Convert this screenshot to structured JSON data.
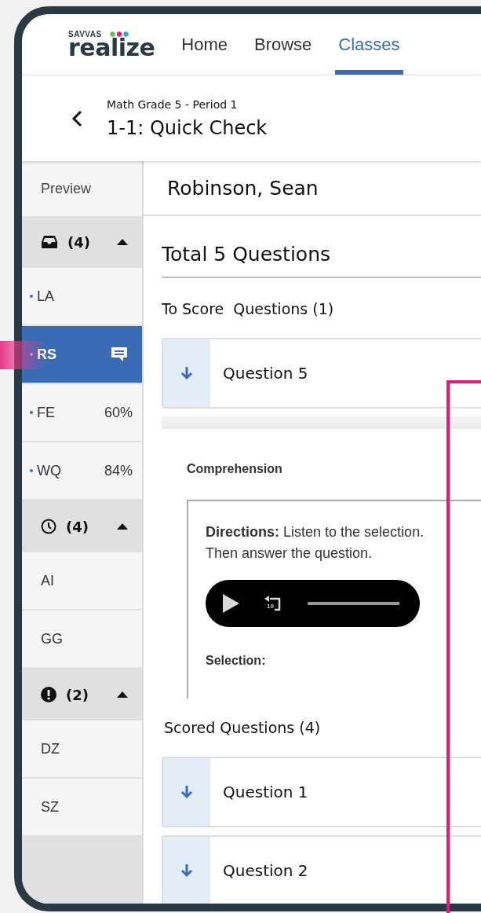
{
  "logo": {
    "brand": "SAVVAS",
    "product": "realize"
  },
  "nav": [
    {
      "label": "Home",
      "selected": false
    },
    {
      "label": "Browse",
      "selected": false
    },
    {
      "label": "Classes",
      "selected": true
    }
  ],
  "breadcrumb": {
    "class_name": "Math Grade 5 - Period 1",
    "title": "1-1: Quick Check"
  },
  "sidebar": {
    "preview": "Preview",
    "groups": [
      {
        "kind": "inbox",
        "count": "(4)",
        "expanded": true,
        "students": [
          {
            "name": "LA",
            "dot": true,
            "selected": false,
            "comment": false
          },
          {
            "name": "RS",
            "dot": true,
            "selected": true,
            "comment": true
          },
          {
            "name": "FE",
            "dot": true,
            "selected": false,
            "comment": false,
            "score": "60%"
          },
          {
            "name": "WQ",
            "dot": true,
            "selected": false,
            "comment": false,
            "score": "84%"
          }
        ]
      },
      {
        "kind": "clock",
        "count": "(4)",
        "expanded": true,
        "students": [
          {
            "name": "AI",
            "dot": false,
            "selected": false,
            "comment": false
          },
          {
            "name": "GG",
            "dot": false,
            "selected": false,
            "comment": false
          }
        ]
      },
      {
        "kind": "alert",
        "count": "(2)",
        "expanded": true,
        "students": [
          {
            "name": "DZ",
            "dot": false,
            "selected": false,
            "comment": false
          },
          {
            "name": "SZ",
            "dot": false,
            "selected": false,
            "comment": false
          }
        ]
      }
    ]
  },
  "student_name": "Robinson, Sean",
  "total": "Total 5 Questions",
  "to_score": {
    "title": "To Score  Questions (1)",
    "questions": [
      {
        "label": "Question 5"
      }
    ]
  },
  "question_detail": {
    "heading": "Comprehension",
    "directions": "**Directions:** Listen to the selection. Then answer the question.",
    "rewind_label": "10",
    "selection": "Selection:"
  },
  "scored": {
    "title": "Scored Questions (4)",
    "questions": [
      {
        "label": "Question 1"
      },
      {
        "label": "Question 2"
      }
    ]
  }
}
